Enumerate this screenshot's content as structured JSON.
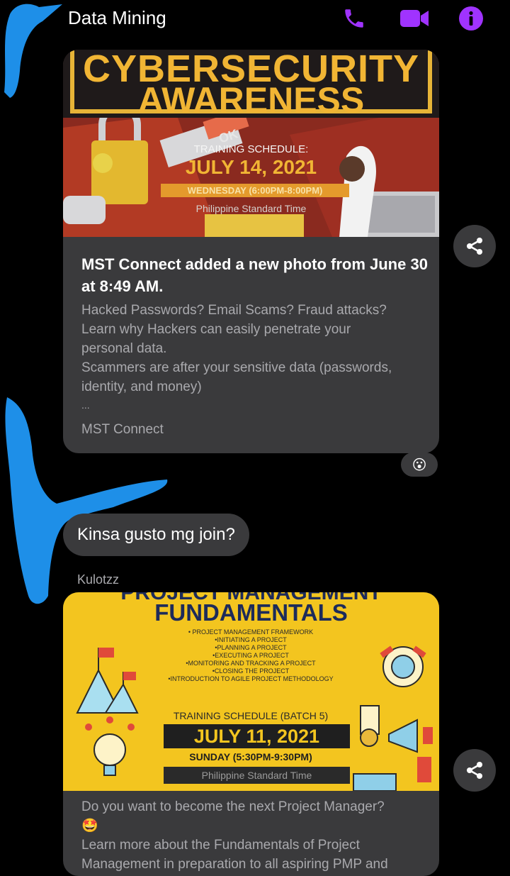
{
  "header": {
    "title": "Data Mining"
  },
  "colors": {
    "accent": "#a033ff",
    "bubble": "#3a3a3c",
    "muted": "#a9a9ad",
    "redaction": "#1e8fe8"
  },
  "post1": {
    "poster": {
      "headline1": "CYBERSECURITY",
      "headline2": "AWARENESS",
      "sticker": "OK",
      "schedule_label": "TRAINING SCHEDULE:",
      "date": "JULY 14, 2021",
      "time": "WEDNESDAY (6:00PM-8:00PM)",
      "tz": "Philippine Standard Time"
    },
    "title": "MST Connect added a new photo from June 30 at 8:49 AM.",
    "desc_lines": [
      "Hacked Passwords? Email Scams? Fraud attacks?",
      "Learn why Hackers can easily penetrate your",
      "personal data.",
      "Scammers are after your sensitive data (passwords,",
      "identity, and money)",
      "..."
    ],
    "source": "MST Connect",
    "reaction": "😮"
  },
  "message": {
    "text": "Kinsa gusto mg join?",
    "sender": "Kulotzz"
  },
  "post2": {
    "poster": {
      "headline1": "PROJECT MANAGEMENT",
      "headline2": "FUNDAMENTALS",
      "bullets": [
        "• PROJECT MANAGEMENT FRAMEWORK",
        "•INITIATING A PROJECT",
        "•PLANNING A PROJECT",
        "•EXECUTING A PROJECT",
        "•MONITORING AND TRACKING A PROJECT",
        "•CLOSING THE PROJECT",
        "•INTRODUCTION TO AGILE PROJECT METHODOLOGY"
      ],
      "schedule_label": "TRAINING SCHEDULE (BATCH 5)",
      "date": "JULY 11, 2021",
      "time": "SUNDAY (5:30PM-9:30PM)",
      "tz": "Philippine Standard Time"
    },
    "desc_lines": [
      "Do you want to become the next Project Manager?",
      "🤩",
      "Learn more about the Fundamentals of Project",
      "Management in preparation to all aspiring PMP and"
    ]
  }
}
